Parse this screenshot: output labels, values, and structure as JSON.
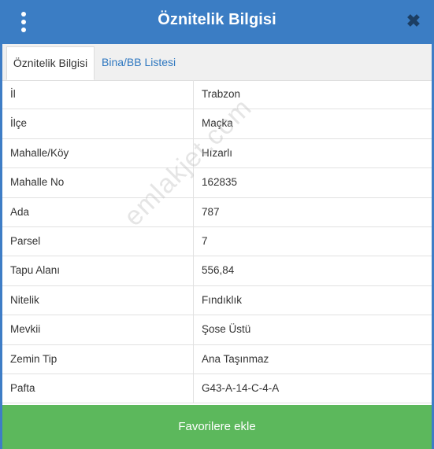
{
  "header": {
    "title": "Öznitelik Bilgisi",
    "close_glyph": "✖",
    "menu_icon": "kebab-vertical-icon"
  },
  "tabs": [
    {
      "label": "Öznitelik Bilgisi",
      "active": true
    },
    {
      "label": "Bina/BB Listesi",
      "active": false
    }
  ],
  "rows": [
    {
      "key": "İl",
      "value": "Trabzon"
    },
    {
      "key": "İlçe",
      "value": "Maçka"
    },
    {
      "key": "Mahalle/Köy",
      "value": "Hızarlı"
    },
    {
      "key": "Mahalle No",
      "value": "162835"
    },
    {
      "key": "Ada",
      "value": "787"
    },
    {
      "key": "Parsel",
      "value": "7"
    },
    {
      "key": "Tapu Alanı",
      "value": "556,84"
    },
    {
      "key": "Nitelik",
      "value": "Fındıklık"
    },
    {
      "key": "Mevkii",
      "value": "Şose Üstü"
    },
    {
      "key": "Zemin Tip",
      "value": "Ana Taşınmaz"
    },
    {
      "key": "Pafta",
      "value": "G43-A-14-C-4-A"
    }
  ],
  "watermark": "emlakjet.com",
  "footer": {
    "button_label": "Favorilere ekle"
  },
  "colors": {
    "header": "#3b7dc4",
    "footer": "#5cb85c",
    "tab_link": "#2f78c0"
  }
}
